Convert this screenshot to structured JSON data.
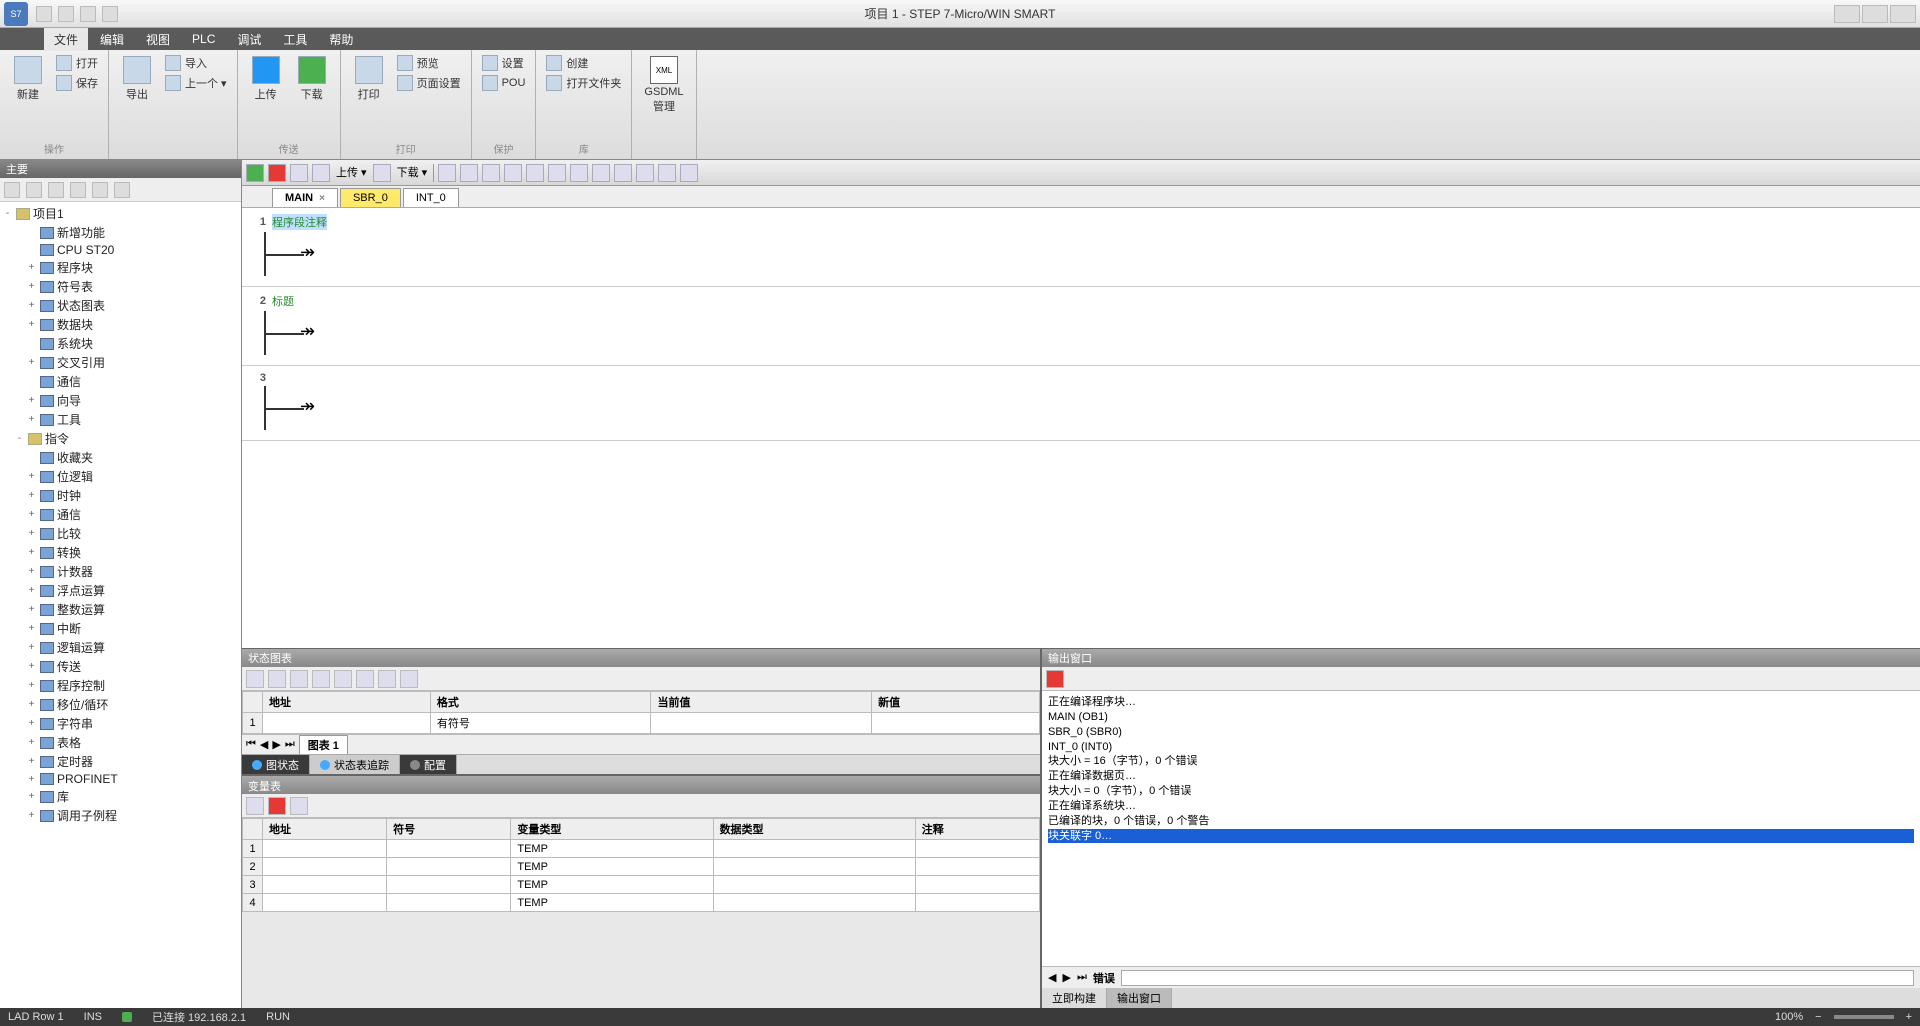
{
  "titlebar": {
    "title": "项目 1 - STEP 7-Micro/WIN SMART"
  },
  "menu": {
    "items": [
      "文件",
      "编辑",
      "视图",
      "PLC",
      "调试",
      "工具",
      "帮助"
    ],
    "active_index": 0
  },
  "ribbon": {
    "groups": [
      {
        "label": "操作",
        "big": [
          {
            "icon": "new-icon",
            "label": "新建"
          }
        ],
        "small": [
          {
            "label": "打开"
          },
          {
            "label": "保存"
          }
        ]
      },
      {
        "label": "",
        "big": [
          {
            "icon": "export-icon",
            "label": "导出"
          }
        ],
        "small": [
          {
            "label": "导入"
          },
          {
            "label": "上一个 ▾"
          }
        ]
      },
      {
        "label": "传送",
        "big": [
          {
            "icon": "upload-icon",
            "label": "上传",
            "cls": "blue"
          },
          {
            "icon": "download-icon",
            "label": "下载",
            "cls": "green"
          }
        ]
      },
      {
        "label": "打印",
        "big": [
          {
            "icon": "print-icon",
            "label": "打印"
          }
        ],
        "small": [
          {
            "label": "预览"
          },
          {
            "label": "页面设置"
          }
        ]
      },
      {
        "label": "保护",
        "small": [
          {
            "label": "设置"
          },
          {
            "label": "POU"
          }
        ]
      },
      {
        "label": "库",
        "small": [
          {
            "label": "创建"
          },
          {
            "label": "打开文件夹"
          }
        ]
      },
      {
        "label": "",
        "big": [
          {
            "icon": "gsdml-icon",
            "label": "GSDML\n管理"
          }
        ]
      }
    ]
  },
  "tree": {
    "title": "主要",
    "root": "项目1",
    "nodes": [
      {
        "l": 1,
        "t": "新增功能"
      },
      {
        "l": 1,
        "t": "CPU ST20"
      },
      {
        "l": 1,
        "t": "程序块",
        "tw": "+"
      },
      {
        "l": 1,
        "t": "符号表",
        "tw": "+"
      },
      {
        "l": 1,
        "t": "状态图表",
        "tw": "+"
      },
      {
        "l": 1,
        "t": "数据块",
        "tw": "+"
      },
      {
        "l": 1,
        "t": "系统块"
      },
      {
        "l": 1,
        "t": "交叉引用",
        "tw": "+"
      },
      {
        "l": 1,
        "t": "通信"
      },
      {
        "l": 1,
        "t": "向导",
        "tw": "+"
      },
      {
        "l": 1,
        "t": "工具",
        "tw": "+"
      },
      {
        "l": 0,
        "t": "指令",
        "tw": "-"
      },
      {
        "l": 1,
        "t": "收藏夹"
      },
      {
        "l": 1,
        "t": "位逻辑",
        "tw": "+"
      },
      {
        "l": 1,
        "t": "时钟",
        "tw": "+"
      },
      {
        "l": 1,
        "t": "通信",
        "tw": "+"
      },
      {
        "l": 1,
        "t": "比较",
        "tw": "+"
      },
      {
        "l": 1,
        "t": "转换",
        "tw": "+"
      },
      {
        "l": 1,
        "t": "计数器",
        "tw": "+"
      },
      {
        "l": 1,
        "t": "浮点运算",
        "tw": "+"
      },
      {
        "l": 1,
        "t": "整数运算",
        "tw": "+"
      },
      {
        "l": 1,
        "t": "中断",
        "tw": "+"
      },
      {
        "l": 1,
        "t": "逻辑运算",
        "tw": "+"
      },
      {
        "l": 1,
        "t": "传送",
        "tw": "+"
      },
      {
        "l": 1,
        "t": "程序控制",
        "tw": "+"
      },
      {
        "l": 1,
        "t": "移位/循环",
        "tw": "+"
      },
      {
        "l": 1,
        "t": "字符串",
        "tw": "+"
      },
      {
        "l": 1,
        "t": "表格",
        "tw": "+"
      },
      {
        "l": 1,
        "t": "定时器",
        "tw": "+"
      },
      {
        "l": 1,
        "t": "PROFINET",
        "tw": "+"
      },
      {
        "l": 1,
        "t": "库",
        "tw": "+"
      },
      {
        "l": 1,
        "t": "调用子例程",
        "tw": "+"
      }
    ]
  },
  "editor": {
    "toolbar_labels": {
      "upload": "上传 ▾",
      "download": "下载 ▾"
    },
    "tabs": [
      {
        "label": "MAIN",
        "active": true,
        "close": true
      },
      {
        "label": "SBR_0",
        "cls": "yellow"
      },
      {
        "label": "INT_0"
      }
    ],
    "networks": [
      {
        "num": "1",
        "title": "程序段注释",
        "sel": true
      },
      {
        "num": "2",
        "title": "标题"
      },
      {
        "num": "3",
        "title": ""
      }
    ]
  },
  "status_chart": {
    "title": "状态图表",
    "headers": [
      "",
      "地址",
      "格式",
      "当前值",
      "新值"
    ],
    "rows": [
      [
        "1",
        "",
        "有符号",
        "",
        ""
      ]
    ],
    "sheet": "图表 1",
    "tabs": [
      "图状态",
      "状态表追踪",
      "配置"
    ]
  },
  "var_table": {
    "title": "变量表",
    "headers": [
      "",
      "地址",
      "符号",
      "变量类型",
      "数据类型",
      "注释"
    ],
    "rows": [
      [
        "1",
        "",
        "",
        "TEMP",
        "",
        ""
      ],
      [
        "2",
        "",
        "",
        "TEMP",
        "",
        ""
      ],
      [
        "3",
        "",
        "",
        "TEMP",
        "",
        ""
      ],
      [
        "4",
        "",
        "",
        "TEMP",
        "",
        ""
      ]
    ]
  },
  "output": {
    "title": "输出窗口",
    "lines": [
      "正在编译程序块…",
      "MAIN (OB1)",
      "SBR_0 (SBR0)",
      "INT_0 (INT0)",
      "块大小 = 16（字节），0 个错误",
      "",
      "正在编译数据页…",
      "块大小 = 0（字节），0 个错误",
      "",
      "正在编译系统块…",
      "已编译的块，0 个错误，0 个警告"
    ],
    "highlight": "块关联字 0…",
    "footer_label": "错误",
    "tabs": [
      "立即构建",
      "输出窗口"
    ]
  },
  "statusbar": {
    "left": "LAD  Row 1",
    "mid": "INS",
    "conn": "已连接 192.168.2.1",
    "run": "RUN",
    "right": "100%"
  }
}
